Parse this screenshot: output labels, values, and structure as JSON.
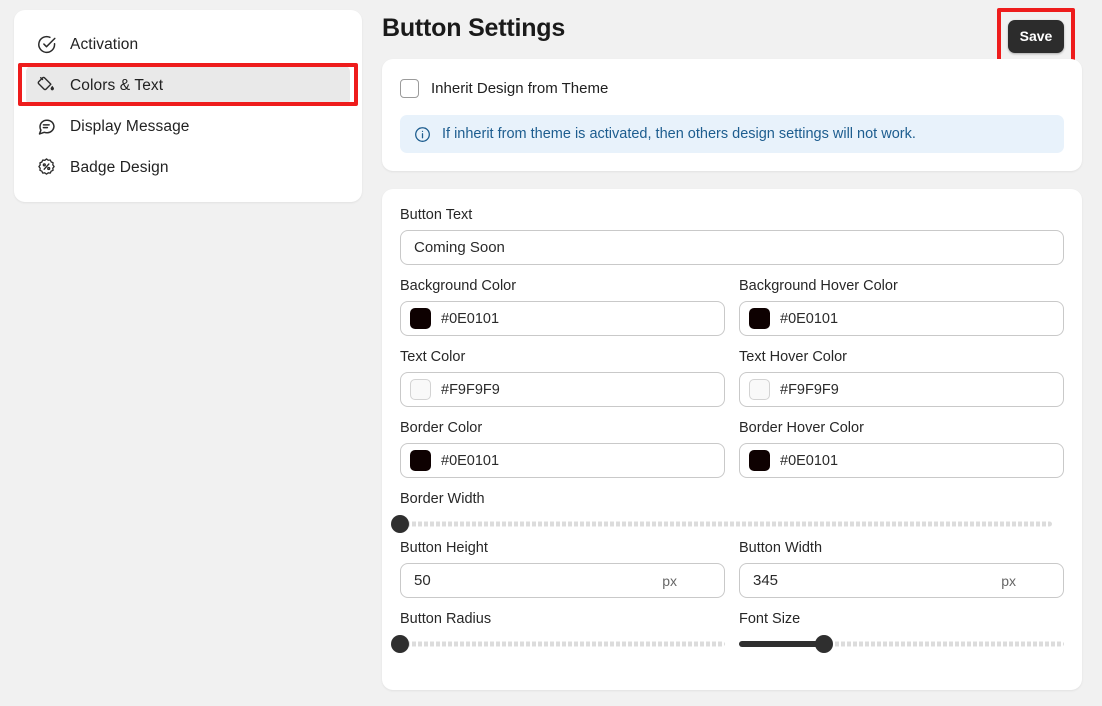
{
  "sidebar": {
    "items": [
      {
        "label": "Activation",
        "icon": "check-circle-icon",
        "selected": false
      },
      {
        "label": "Colors & Text",
        "icon": "color-drop-icon",
        "selected": true
      },
      {
        "label": "Display Message",
        "icon": "chat-message-icon",
        "selected": false
      },
      {
        "label": "Badge Design",
        "icon": "badge-percent-icon",
        "selected": false
      }
    ],
    "highlight_color": "#EE1C1C"
  },
  "header": {
    "title": "Button Settings",
    "save_label": "Save",
    "save_bg": "#2C2C2C",
    "highlight_color": "#EE1C1C"
  },
  "inherit": {
    "checkbox_label": "Inherit Design from Theme",
    "checked": false,
    "info_text": "If inherit from theme is activated, then others design settings will not work.",
    "info_icon": "info-circle-icon",
    "info_bg": "#E8F2FB",
    "info_fg": "#1D5D8F"
  },
  "settings": {
    "button_text": {
      "label": "Button Text",
      "value": "Coming Soon",
      "placeholder": "Button Text"
    },
    "background_color": {
      "label": "Background Color",
      "value": "#0E0101"
    },
    "background_hover_color": {
      "label": "Background Hover Color",
      "value": "#0E0101"
    },
    "text_color": {
      "label": "Text Color",
      "value": "#F9F9F9"
    },
    "text_hover_color": {
      "label": "Text Hover Color",
      "value": "#F9F9F9"
    },
    "border_color": {
      "label": "Border Color",
      "value": "#0E0101"
    },
    "border_hover_color": {
      "label": "Border Hover Color",
      "value": "#0E0101"
    },
    "border_width": {
      "label": "Border Width",
      "percent": 0
    },
    "button_height": {
      "label": "Button Height",
      "value": "50",
      "unit": "px"
    },
    "button_width": {
      "label": "Button Width",
      "value": "345",
      "unit": "px"
    },
    "button_radius": {
      "label": "Button Radius",
      "percent": 0
    },
    "font_size": {
      "label": "Font Size",
      "percent": 26
    }
  }
}
